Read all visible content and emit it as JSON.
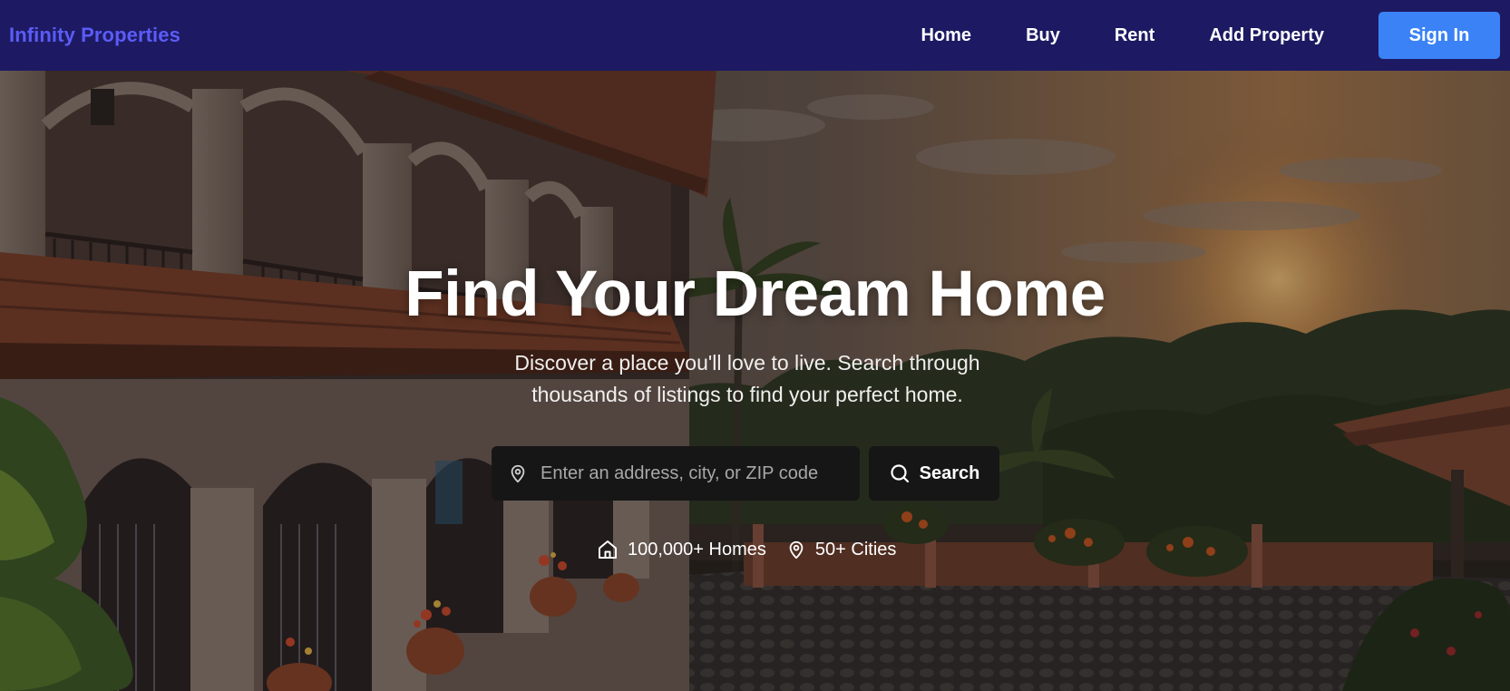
{
  "nav": {
    "brand": "Infinity Properties",
    "links": [
      "Home",
      "Buy",
      "Rent",
      "Add Property"
    ],
    "signin": "Sign In"
  },
  "hero": {
    "title": "Find Your Dream Home",
    "subtitle": "Discover a place you'll love to live. Search through thousands of listings to find your perfect home.",
    "search": {
      "placeholder": "Enter an address, city, or ZIP code",
      "value": "",
      "button": "Search",
      "input_icon": "map-pin-icon",
      "button_icon": "search-icon"
    },
    "stats": [
      {
        "icon": "home-icon",
        "text": "100,000+ Homes"
      },
      {
        "icon": "map-pin-icon",
        "text": "50+ Cities"
      }
    ]
  },
  "colors": {
    "navbar": "#1d1a63",
    "brand": "#5b5cf6",
    "signin": "#3b82f6",
    "search_bg": "#161616"
  }
}
